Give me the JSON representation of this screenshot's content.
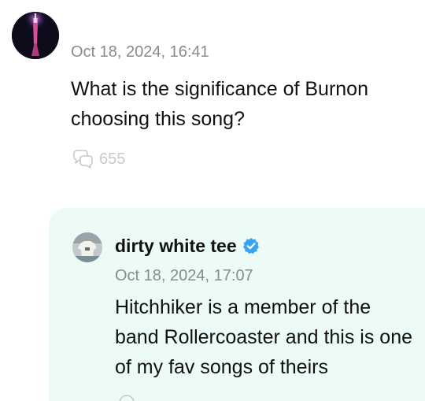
{
  "post": {
    "timestamp": "Oct 18, 2024, 16:41",
    "text": "What is the significance of Burnon choosing this song?",
    "reaction_count": "655",
    "reaction_icon": "reply-bubbles-icon"
  },
  "reply": {
    "username": "dirty white tee",
    "verified": true,
    "timestamp": "Oct 18, 2024, 17:07",
    "text": "Hitchhiker is a member of the band Rollercoaster and this is one of my fav songs of theirs"
  },
  "colors": {
    "reply_background": "#ecfbf6",
    "verified_badge": "#3aa3f0",
    "muted_text": "#8a8a8a",
    "reaction_icon": "#c9c9c9"
  }
}
